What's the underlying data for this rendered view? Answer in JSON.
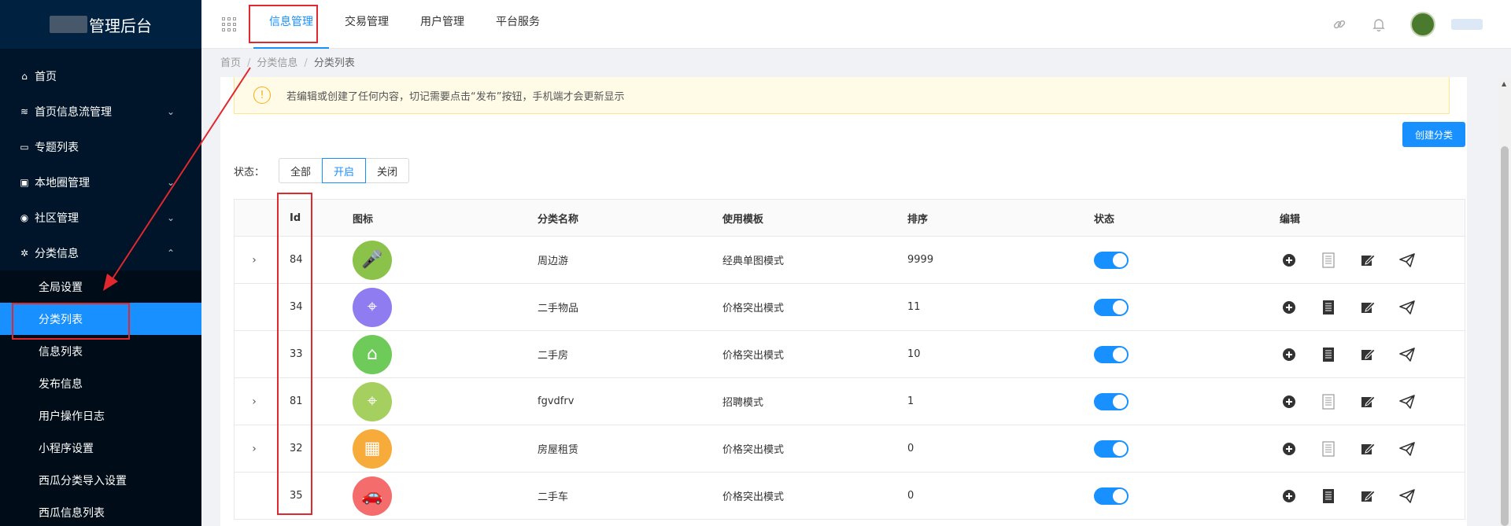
{
  "app": {
    "title": "管理后台"
  },
  "sidebar": {
    "items": [
      {
        "label": "首页",
        "icon": "home-icon",
        "glyph": "⌂",
        "has_children": false
      },
      {
        "label": "首页信息流管理",
        "icon": "rss-icon",
        "glyph": "≋",
        "has_children": true
      },
      {
        "label": "专题列表",
        "icon": "folder-icon",
        "glyph": "▭",
        "has_children": false
      },
      {
        "label": "本地圈管理",
        "icon": "ticket-icon",
        "glyph": "▣",
        "has_children": true
      },
      {
        "label": "社区管理",
        "icon": "user-circle-icon",
        "glyph": "◉",
        "has_children": true
      },
      {
        "label": "分类信息",
        "icon": "settings-icon",
        "glyph": "✲",
        "has_children": true,
        "expanded": true
      }
    ],
    "subitems": [
      {
        "label": "全局设置",
        "active": false
      },
      {
        "label": "分类列表",
        "active": true
      },
      {
        "label": "信息列表",
        "active": false
      },
      {
        "label": "发布信息",
        "active": false
      },
      {
        "label": "用户操作日志",
        "active": false
      },
      {
        "label": "小程序设置",
        "active": false
      },
      {
        "label": "西瓜分类导入设置",
        "active": false
      },
      {
        "label": "西瓜信息列表",
        "active": false
      }
    ]
  },
  "header": {
    "tabs": [
      {
        "label": "信息管理",
        "active": true
      },
      {
        "label": "交易管理",
        "active": false
      },
      {
        "label": "用户管理",
        "active": false
      },
      {
        "label": "平台服务",
        "active": false
      }
    ],
    "icons": [
      "link-icon",
      "bell-icon"
    ]
  },
  "breadcrumb": {
    "items": [
      "首页",
      "分类信息",
      "分类列表"
    ]
  },
  "alert": {
    "text": "若编辑或创建了任何内容，切记需要点击“发布”按钮，手机端才会更新显示"
  },
  "actions": {
    "create_label": "创建分类"
  },
  "filter": {
    "label": "状态：",
    "options": [
      "全部",
      "开启",
      "关闭"
    ],
    "selected": "开启"
  },
  "table": {
    "columns": [
      "Id",
      "图标",
      "分类名称",
      "使用模板",
      "排序",
      "状态",
      "编辑"
    ],
    "rows": [
      {
        "expandable": true,
        "id": "84",
        "icon_color": "#8bc34a",
        "icon": "microphone-icon",
        "glyph": "🎤",
        "name": "周边游",
        "template": "经典单图模式",
        "sort": "9999",
        "enabled": true,
        "doc_filled": false
      },
      {
        "expandable": false,
        "id": "34",
        "icon_color": "#8e7cf0",
        "icon": "location-pin-icon",
        "glyph": "⌖",
        "name": "二手物品",
        "template": "价格突出模式",
        "sort": "11",
        "enabled": true,
        "doc_filled": true
      },
      {
        "expandable": false,
        "id": "33",
        "icon_color": "#6ecb5a",
        "icon": "house-icon",
        "glyph": "⌂",
        "name": "二手房",
        "template": "价格突出模式",
        "sort": "10",
        "enabled": true,
        "doc_filled": true
      },
      {
        "expandable": true,
        "id": "81",
        "icon_color": "#a5cf5e",
        "icon": "location-pin-icon",
        "glyph": "⌖",
        "name": "fgvdfrv",
        "template": "招聘模式",
        "sort": "1",
        "enabled": true,
        "doc_filled": false
      },
      {
        "expandable": true,
        "id": "32",
        "icon_color": "#f7ab3b",
        "icon": "building-icon",
        "glyph": "▦",
        "name": "房屋租赁",
        "template": "价格突出模式",
        "sort": "0",
        "enabled": true,
        "doc_filled": false
      },
      {
        "expandable": false,
        "id": "35",
        "icon_color": "#f56c6c",
        "icon": "car-icon",
        "glyph": "🚗",
        "name": "二手车",
        "template": "价格突出模式",
        "sort": "0",
        "enabled": true,
        "doc_filled": true
      }
    ]
  },
  "colors": {
    "primary": "#1890ff",
    "sidebar_bg": "#001529",
    "annotation": "#e0282e",
    "warning": "#faad14"
  }
}
